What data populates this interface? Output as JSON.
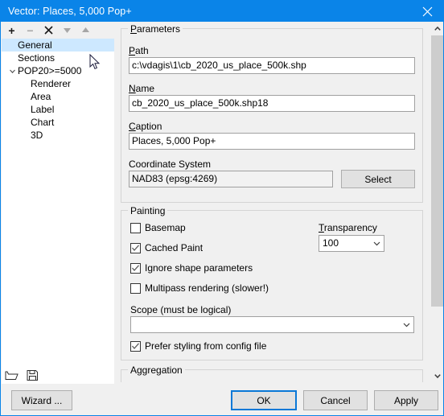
{
  "window": {
    "title": "Vector: Places, 5,000 Pop+",
    "close_icon": "close-icon",
    "accent_color": "#0a84e8"
  },
  "tree_toolbar": {
    "items": [
      {
        "name": "add-button",
        "glyph": "+",
        "enabled": true
      },
      {
        "name": "remove-button",
        "glyph": "−",
        "enabled": false
      },
      {
        "name": "delete-button",
        "glyph": "✕",
        "enabled": true
      },
      {
        "name": "move-down-button",
        "glyph": "▼",
        "enabled": false
      },
      {
        "name": "move-up-button",
        "glyph": "▲",
        "enabled": false
      }
    ]
  },
  "tree": {
    "items": [
      {
        "label": "General",
        "level": 0,
        "selected": true,
        "expander": "none"
      },
      {
        "label": "Sections",
        "level": 0,
        "selected": false,
        "expander": "none"
      },
      {
        "label": "POP20>=5000",
        "level": 1,
        "selected": false,
        "expander": "expanded"
      },
      {
        "label": "Renderer",
        "level": 2,
        "selected": false,
        "expander": "none"
      },
      {
        "label": "Area",
        "level": 2,
        "selected": false,
        "expander": "none"
      },
      {
        "label": "Label",
        "level": 2,
        "selected": false,
        "expander": "none"
      },
      {
        "label": "Chart",
        "level": 2,
        "selected": false,
        "expander": "none"
      },
      {
        "label": "3D",
        "level": 2,
        "selected": false,
        "expander": "none"
      }
    ]
  },
  "left_bottom": {
    "open_icon": "folder-open-icon",
    "save_icon": "save-disk-icon"
  },
  "parameters": {
    "legend": "Parameters",
    "path": {
      "label": "Path",
      "accel": "P",
      "value": "c:\\vdagis\\1\\cb_2020_us_place_500k.shp"
    },
    "name": {
      "label": "Name",
      "accel": "N",
      "value": "cb_2020_us_place_500k.shp18"
    },
    "caption": {
      "label": "Caption",
      "accel": "C",
      "value": "Places, 5,000 Pop+"
    },
    "coordinate_system": {
      "label": "Coordinate System",
      "value": "NAD83 (epsg:4269)",
      "select_button": "Select"
    }
  },
  "painting": {
    "legend": "Painting",
    "checkboxes": [
      {
        "label": "Basemap",
        "checked": false
      },
      {
        "label": "Cached Paint",
        "checked": true
      },
      {
        "label": "Ignore shape parameters",
        "checked": true
      },
      {
        "label": "Multipass rendering (slower!)",
        "checked": false
      }
    ],
    "transparency": {
      "label": "Transparency",
      "accel": "T",
      "value": "100"
    },
    "scope": {
      "label": "Scope (must be logical)",
      "value": ""
    },
    "prefer_styling": {
      "label": "Prefer styling from config file",
      "checked": true
    }
  },
  "aggregation": {
    "legend": "Aggregation"
  },
  "scrollbar": {
    "up_icon": "chevron-up-icon",
    "down_icon": "chevron-down-icon"
  },
  "footer": {
    "wizard_button": "Wizard ...",
    "ok_button": "OK",
    "cancel_button": "Cancel",
    "apply_button": "Apply"
  }
}
